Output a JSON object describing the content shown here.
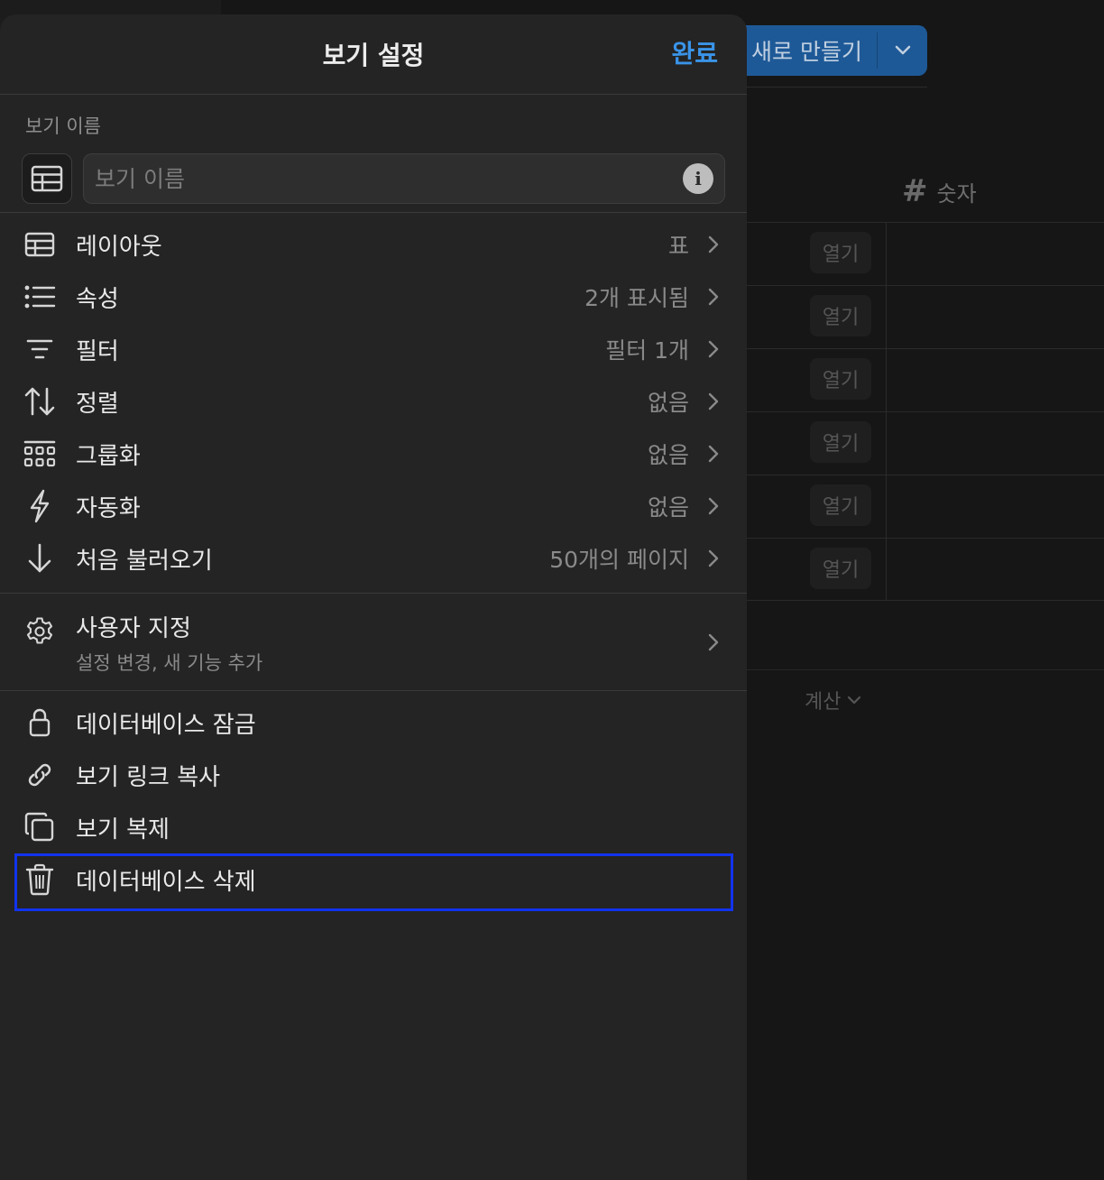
{
  "background": {
    "new_button_label": "새로 만들기",
    "column_header": {
      "icon": "hash-icon",
      "label": "숫자"
    },
    "open_chip_label": "열기",
    "open_chips": [
      "열기",
      "열기",
      "열기",
      "열기",
      "열기",
      "열기"
    ],
    "calc_label": "계산"
  },
  "sheet": {
    "title": "보기 설정",
    "done_label": "완료",
    "name_section_label": "보기 이름",
    "name_input_value": "",
    "name_input_placeholder": "보기 이름",
    "settings": [
      {
        "icon": "table-icon",
        "label": "레이아웃",
        "value": "표"
      },
      {
        "icon": "list-icon",
        "label": "속성",
        "value": "2개 표시됨"
      },
      {
        "icon": "filter-icon",
        "label": "필터",
        "value": "필터 1개"
      },
      {
        "icon": "sort-icon",
        "label": "정렬",
        "value": "없음"
      },
      {
        "icon": "group-icon",
        "label": "그룹화",
        "value": "없음"
      },
      {
        "icon": "lightning-icon",
        "label": "자동화",
        "value": "없음"
      },
      {
        "icon": "arrow-down-icon",
        "label": "처음 불러오기",
        "value": "50개의 페이지"
      }
    ],
    "customize": {
      "icon": "gear-icon",
      "label": "사용자 지정",
      "sublabel": "설정 변경, 새 기능 추가"
    },
    "actions": [
      {
        "icon": "lock-icon",
        "label": "데이터베이스 잠금"
      },
      {
        "icon": "link-icon",
        "label": "보기 링크 복사"
      },
      {
        "icon": "duplicate-icon",
        "label": "보기 복제"
      },
      {
        "icon": "trash-icon",
        "label": "데이터베이스 삭제"
      }
    ]
  },
  "colors": {
    "accent": "#3a94e8",
    "sheet_bg": "#242424",
    "highlight": "#1133ee"
  }
}
